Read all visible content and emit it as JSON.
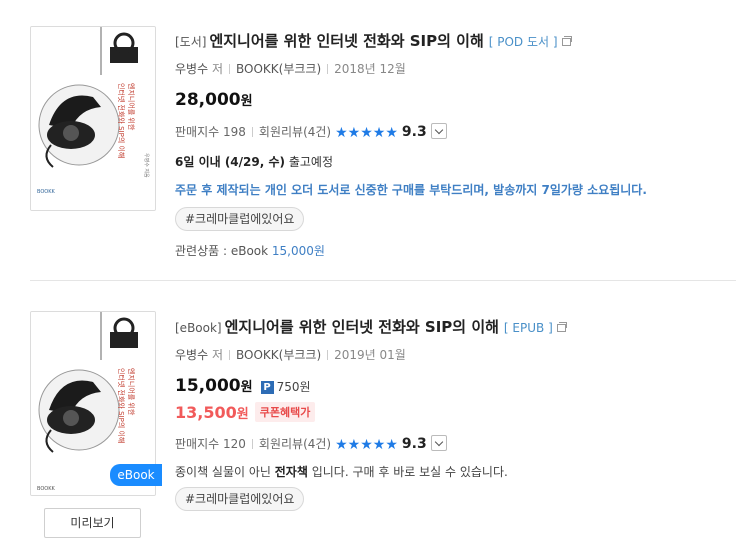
{
  "items": [
    {
      "category": "[도서]",
      "title": "엔지니어를 위한 인터넷 전화와 SIP의 이해",
      "format": "[ POD 도서 ]",
      "author": "우병수",
      "author_suffix": "저",
      "publisher": "BOOKK(부크크)",
      "date": "2018년 12월",
      "price": "28,000",
      "won": "원",
      "sales_label": "판매지수",
      "sales_index": "198",
      "review_label": "회원리뷰",
      "review_count": "(4건)",
      "stars": "★★★★★",
      "rating": "9.3",
      "shipping_bold": "6일 이내 (4/29, 수)",
      "shipping_rest": " 출고예정",
      "notice": "주문 후 제작되는 개인 오더 도서로 신중한 구매를 부탁드리며, 발송까지 7일가량 소요됩니다.",
      "tag": "#크레마클럽에있어요",
      "related_label": "관련상품 : eBook ",
      "related_price": "15,000원",
      "star_color": "#1f7be6"
    },
    {
      "category": "[eBook]",
      "title": "엔지니어를 위한 인터넷 전화와 SIP의 이해",
      "format": "[ EPUB ]",
      "author": "우병수",
      "author_suffix": "저",
      "publisher": "BOOKK(부크크)",
      "date": "2019년 01월",
      "price": "15,000",
      "won": "원",
      "points_icon": "P",
      "points": "750원",
      "sale_price": "13,500",
      "sale_won": "원",
      "coupon": "쿠폰혜택가",
      "sales_label": "판매지수",
      "sales_index": "120",
      "review_label": "회원리뷰",
      "review_count": "(4건)",
      "stars": "★★★★★",
      "rating": "9.3",
      "desc_pre": "종이책 실물이 아닌 ",
      "desc_bold": "전자책",
      "desc_post": " 입니다. 구매 후 바로 보실 수 있습니다.",
      "tag": "#크레마클럽에있어요",
      "ebook_badge": "eBook",
      "preview_button": "미리보기"
    }
  ],
  "cover": {
    "title_line1": "엔지니어를 위한",
    "title_line2": "인터넷 전화와 SIP의 이해",
    "author": "우병수 지음",
    "publisher_logo": "BOOKK"
  }
}
